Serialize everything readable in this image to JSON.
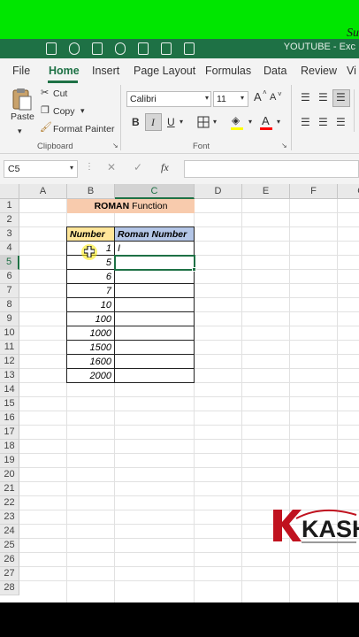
{
  "banner": {
    "text": "Su"
  },
  "titlebar": {
    "right_text": "YOUTUBE - Exc"
  },
  "ribbon_tabs": [
    "File",
    "Home",
    "Insert",
    "Page Layout",
    "Formulas",
    "Data",
    "Review",
    "Vi"
  ],
  "clipboard": {
    "paste": "Paste",
    "cut": "Cut",
    "copy": "Copy",
    "format_painter": "Format Painter",
    "group": "Clipboard"
  },
  "font": {
    "name": "Calibri",
    "size": "11",
    "group": "Font",
    "bold": "B",
    "italic": "I",
    "underline": "U"
  },
  "formula_bar": {
    "name_box": "C5",
    "fx": "fx",
    "formula": ""
  },
  "columns": [
    "A",
    "B",
    "C",
    "D",
    "E",
    "F",
    "G"
  ],
  "rows": [
    "1",
    "2",
    "3",
    "4",
    "5",
    "6",
    "7",
    "8",
    "9",
    "10",
    "11",
    "12",
    "13",
    "14",
    "15",
    "16",
    "17",
    "18",
    "19",
    "20",
    "21",
    "22",
    "23",
    "24",
    "25",
    "26",
    "27",
    "28"
  ],
  "sheet": {
    "title_bold": "ROMAN",
    "title_rest": " Function",
    "header_number": "Number",
    "header_roman": "Roman Number",
    "numbers": [
      "1",
      "5",
      "6",
      "7",
      "10",
      "100",
      "1000",
      "1500",
      "1600",
      "2000"
    ],
    "roman_c4": "I"
  },
  "watermark": {
    "logo": "KASH"
  },
  "colors": {
    "accent": "#1e7145",
    "banner": "#00e600",
    "title_fill": "#f8cbad",
    "header_fill": "#ffe699",
    "header2_fill": "#b4c6e7"
  }
}
